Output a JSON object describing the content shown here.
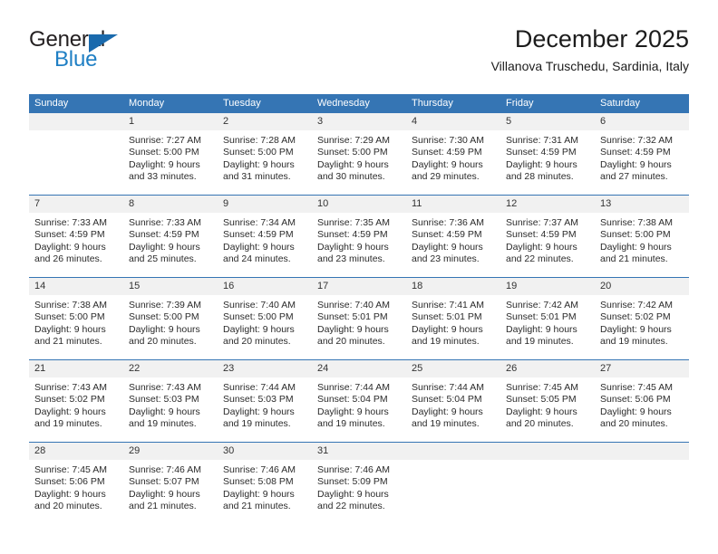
{
  "brand": {
    "word_one": "General",
    "word_two": "Blue",
    "triangle_icon": "triangle-logo-icon"
  },
  "header": {
    "title": "December 2025",
    "subtitle": "Villanova Truschedu, Sardinia, Italy"
  },
  "colors": {
    "header_blue": "#3575b4",
    "band_gray": "#f1f1f1",
    "brand_blue": "#1f7fc4",
    "text": "#2b2b2b"
  },
  "calendar": {
    "weekdays": [
      "Sunday",
      "Monday",
      "Tuesday",
      "Wednesday",
      "Thursday",
      "Friday",
      "Saturday"
    ],
    "weeks": [
      [
        {
          "day": "",
          "lines": []
        },
        {
          "day": "1",
          "lines": [
            "Sunrise: 7:27 AM",
            "Sunset: 5:00 PM",
            "Daylight: 9 hours",
            "and 33 minutes."
          ]
        },
        {
          "day": "2",
          "lines": [
            "Sunrise: 7:28 AM",
            "Sunset: 5:00 PM",
            "Daylight: 9 hours",
            "and 31 minutes."
          ]
        },
        {
          "day": "3",
          "lines": [
            "Sunrise: 7:29 AM",
            "Sunset: 5:00 PM",
            "Daylight: 9 hours",
            "and 30 minutes."
          ]
        },
        {
          "day": "4",
          "lines": [
            "Sunrise: 7:30 AM",
            "Sunset: 4:59 PM",
            "Daylight: 9 hours",
            "and 29 minutes."
          ]
        },
        {
          "day": "5",
          "lines": [
            "Sunrise: 7:31 AM",
            "Sunset: 4:59 PM",
            "Daylight: 9 hours",
            "and 28 minutes."
          ]
        },
        {
          "day": "6",
          "lines": [
            "Sunrise: 7:32 AM",
            "Sunset: 4:59 PM",
            "Daylight: 9 hours",
            "and 27 minutes."
          ]
        }
      ],
      [
        {
          "day": "7",
          "lines": [
            "Sunrise: 7:33 AM",
            "Sunset: 4:59 PM",
            "Daylight: 9 hours",
            "and 26 minutes."
          ]
        },
        {
          "day": "8",
          "lines": [
            "Sunrise: 7:33 AM",
            "Sunset: 4:59 PM",
            "Daylight: 9 hours",
            "and 25 minutes."
          ]
        },
        {
          "day": "9",
          "lines": [
            "Sunrise: 7:34 AM",
            "Sunset: 4:59 PM",
            "Daylight: 9 hours",
            "and 24 minutes."
          ]
        },
        {
          "day": "10",
          "lines": [
            "Sunrise: 7:35 AM",
            "Sunset: 4:59 PM",
            "Daylight: 9 hours",
            "and 23 minutes."
          ]
        },
        {
          "day": "11",
          "lines": [
            "Sunrise: 7:36 AM",
            "Sunset: 4:59 PM",
            "Daylight: 9 hours",
            "and 23 minutes."
          ]
        },
        {
          "day": "12",
          "lines": [
            "Sunrise: 7:37 AM",
            "Sunset: 4:59 PM",
            "Daylight: 9 hours",
            "and 22 minutes."
          ]
        },
        {
          "day": "13",
          "lines": [
            "Sunrise: 7:38 AM",
            "Sunset: 5:00 PM",
            "Daylight: 9 hours",
            "and 21 minutes."
          ]
        }
      ],
      [
        {
          "day": "14",
          "lines": [
            "Sunrise: 7:38 AM",
            "Sunset: 5:00 PM",
            "Daylight: 9 hours",
            "and 21 minutes."
          ]
        },
        {
          "day": "15",
          "lines": [
            "Sunrise: 7:39 AM",
            "Sunset: 5:00 PM",
            "Daylight: 9 hours",
            "and 20 minutes."
          ]
        },
        {
          "day": "16",
          "lines": [
            "Sunrise: 7:40 AM",
            "Sunset: 5:00 PM",
            "Daylight: 9 hours",
            "and 20 minutes."
          ]
        },
        {
          "day": "17",
          "lines": [
            "Sunrise: 7:40 AM",
            "Sunset: 5:01 PM",
            "Daylight: 9 hours",
            "and 20 minutes."
          ]
        },
        {
          "day": "18",
          "lines": [
            "Sunrise: 7:41 AM",
            "Sunset: 5:01 PM",
            "Daylight: 9 hours",
            "and 19 minutes."
          ]
        },
        {
          "day": "19",
          "lines": [
            "Sunrise: 7:42 AM",
            "Sunset: 5:01 PM",
            "Daylight: 9 hours",
            "and 19 minutes."
          ]
        },
        {
          "day": "20",
          "lines": [
            "Sunrise: 7:42 AM",
            "Sunset: 5:02 PM",
            "Daylight: 9 hours",
            "and 19 minutes."
          ]
        }
      ],
      [
        {
          "day": "21",
          "lines": [
            "Sunrise: 7:43 AM",
            "Sunset: 5:02 PM",
            "Daylight: 9 hours",
            "and 19 minutes."
          ]
        },
        {
          "day": "22",
          "lines": [
            "Sunrise: 7:43 AM",
            "Sunset: 5:03 PM",
            "Daylight: 9 hours",
            "and 19 minutes."
          ]
        },
        {
          "day": "23",
          "lines": [
            "Sunrise: 7:44 AM",
            "Sunset: 5:03 PM",
            "Daylight: 9 hours",
            "and 19 minutes."
          ]
        },
        {
          "day": "24",
          "lines": [
            "Sunrise: 7:44 AM",
            "Sunset: 5:04 PM",
            "Daylight: 9 hours",
            "and 19 minutes."
          ]
        },
        {
          "day": "25",
          "lines": [
            "Sunrise: 7:44 AM",
            "Sunset: 5:04 PM",
            "Daylight: 9 hours",
            "and 19 minutes."
          ]
        },
        {
          "day": "26",
          "lines": [
            "Sunrise: 7:45 AM",
            "Sunset: 5:05 PM",
            "Daylight: 9 hours",
            "and 20 minutes."
          ]
        },
        {
          "day": "27",
          "lines": [
            "Sunrise: 7:45 AM",
            "Sunset: 5:06 PM",
            "Daylight: 9 hours",
            "and 20 minutes."
          ]
        }
      ],
      [
        {
          "day": "28",
          "lines": [
            "Sunrise: 7:45 AM",
            "Sunset: 5:06 PM",
            "Daylight: 9 hours",
            "and 20 minutes."
          ]
        },
        {
          "day": "29",
          "lines": [
            "Sunrise: 7:46 AM",
            "Sunset: 5:07 PM",
            "Daylight: 9 hours",
            "and 21 minutes."
          ]
        },
        {
          "day": "30",
          "lines": [
            "Sunrise: 7:46 AM",
            "Sunset: 5:08 PM",
            "Daylight: 9 hours",
            "and 21 minutes."
          ]
        },
        {
          "day": "31",
          "lines": [
            "Sunrise: 7:46 AM",
            "Sunset: 5:09 PM",
            "Daylight: 9 hours",
            "and 22 minutes."
          ]
        },
        {
          "day": "",
          "lines": []
        },
        {
          "day": "",
          "lines": []
        },
        {
          "day": "",
          "lines": []
        }
      ]
    ]
  }
}
